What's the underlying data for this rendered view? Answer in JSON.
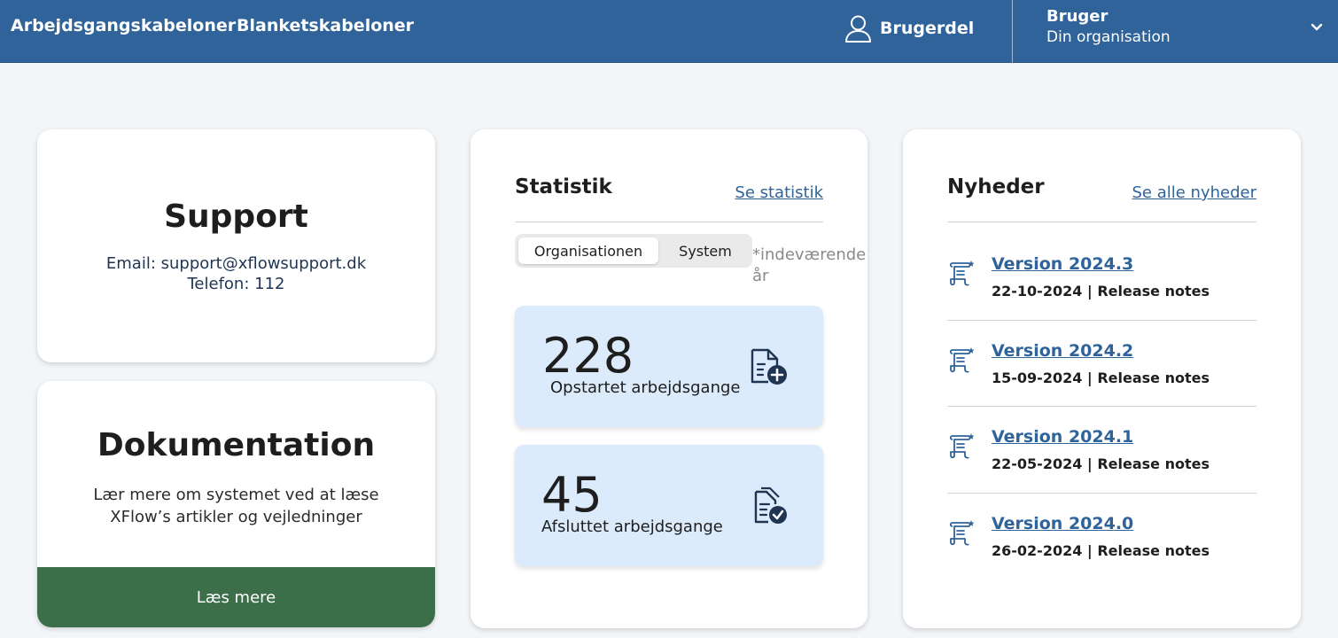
{
  "topbar": {
    "nav": [
      "Arbejdsgangskabeloner",
      "Blanketskabeloner"
    ],
    "user_part_label": "Brugerdel",
    "user_name": "Bruger",
    "user_org": "Din organisation",
    "user_icon": "user-outline-icon",
    "chevron_icon": "chevron-down-icon",
    "bg_color": "#2f6399"
  },
  "support": {
    "title": "Support",
    "email": "Email: support@xflowsupport.dk",
    "phone": "Telefon: 112"
  },
  "documentation": {
    "title": "Dokumentation",
    "description_line1": "Lær mere om systemet ved at læse",
    "description_line2": "XFlow’s artikler og vejledninger",
    "button_label": "Læs mere",
    "button_color": "#3d6e4a"
  },
  "statistics": {
    "title": "Statistik",
    "link": "Se statistik",
    "toggle": {
      "selected": "Organisationen",
      "other": "System"
    },
    "note_line1": "*indeværende",
    "note_line2": "år",
    "items": [
      {
        "value": "228",
        "label": "Opstartet arbejdsgange",
        "icon": "document-add-icon"
      },
      {
        "value": "45",
        "label": "Afsluttet arbejdsgange",
        "icon": "document-check-icon"
      }
    ],
    "box_color": "#dcebfb"
  },
  "news": {
    "title": "Nyheder",
    "link": "Se alle nyheder",
    "items": [
      {
        "version": "Version 2024.3",
        "meta": "22-10-2024 | Release notes",
        "icon": "scroll-icon"
      },
      {
        "version": "Version 2024.2",
        "meta": "15-09-2024 | Release notes",
        "icon": "scroll-icon"
      },
      {
        "version": "Version 2024.1",
        "meta": "22-05-2024 | Release notes",
        "icon": "scroll-icon"
      },
      {
        "version": "Version 2024.0",
        "meta": "26-02-2024 | Release notes",
        "icon": "scroll-icon"
      }
    ],
    "link_color": "#2f6399"
  }
}
